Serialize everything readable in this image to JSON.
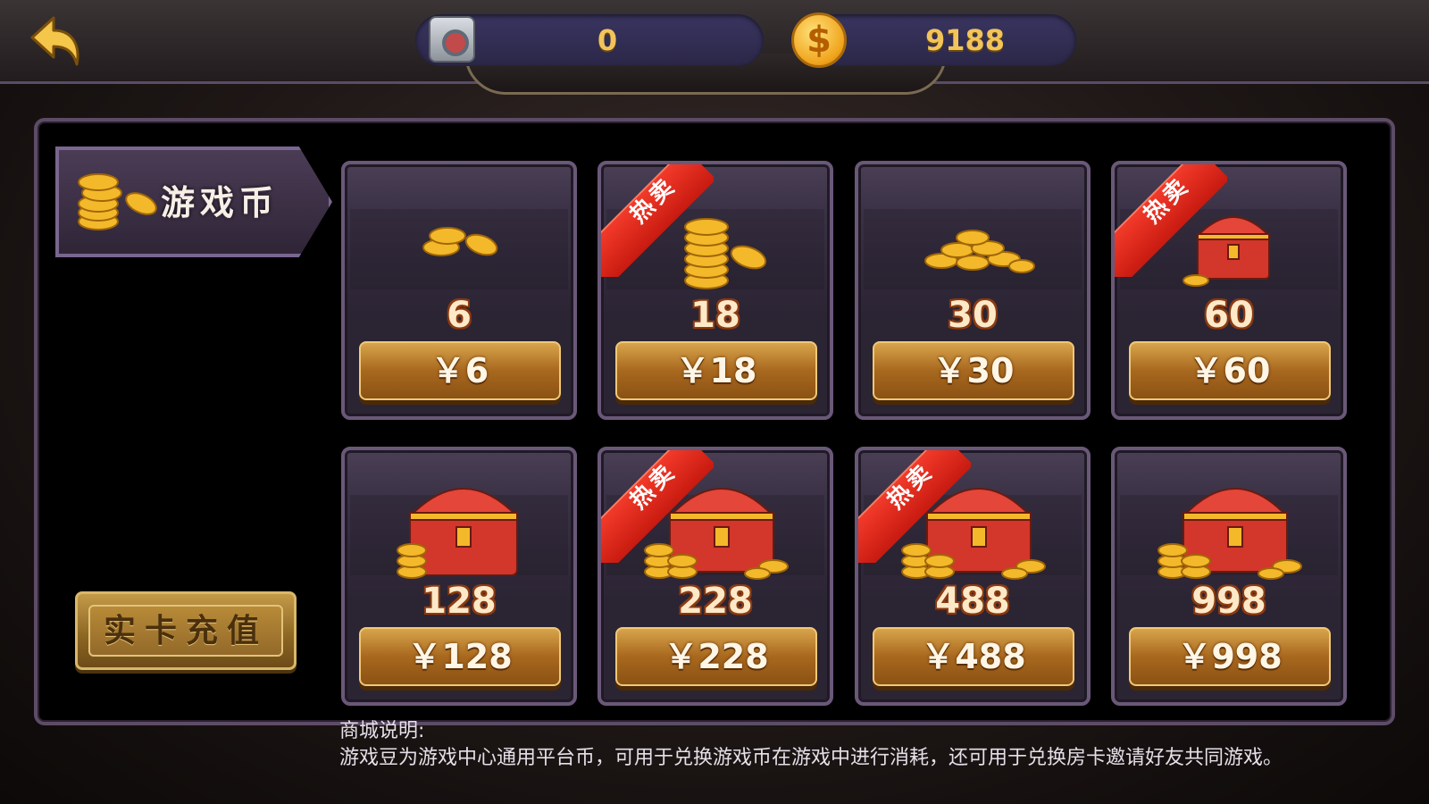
{
  "header": {
    "back_icon": "back-arrow-icon",
    "safe_icon": "safe-icon",
    "safe_value": "0",
    "coin_icon": "gold-coin-icon",
    "coin_symbol": "$",
    "coin_value": "9188"
  },
  "sidebar": {
    "category_label": "游戏币",
    "category_icon": "coin-stack-icon",
    "card_recharge_label": "实卡充值"
  },
  "products": [
    {
      "amount": "6",
      "price": "￥6",
      "hot": false,
      "icon": "coin-small-icon"
    },
    {
      "amount": "18",
      "price": "￥18",
      "hot": true,
      "icon": "coin-stack-icon"
    },
    {
      "amount": "30",
      "price": "￥30",
      "hot": false,
      "icon": "coin-pile-icon"
    },
    {
      "amount": "60",
      "price": "￥60",
      "hot": true,
      "icon": "small-chest-icon"
    },
    {
      "amount": "128",
      "price": "￥128",
      "hot": false,
      "icon": "chest-icon"
    },
    {
      "amount": "228",
      "price": "￥228",
      "hot": true,
      "icon": "chest-coins-icon"
    },
    {
      "amount": "488",
      "price": "￥488",
      "hot": true,
      "icon": "chest-coins-icon"
    },
    {
      "amount": "998",
      "price": "￥998",
      "hot": false,
      "icon": "chest-coins-icon"
    }
  ],
  "hot_label": "热卖",
  "notes": {
    "title": "商城说明:",
    "body": "游戏豆为游戏中心通用平台币，可用于兑换游戏币在游戏中进行消耗，还可用于兑换房卡邀请好友共同游戏。"
  },
  "colors": {
    "accent_gold": "#f2c45a",
    "hot_red": "#e02a1c",
    "panel_border": "#6a5878"
  }
}
